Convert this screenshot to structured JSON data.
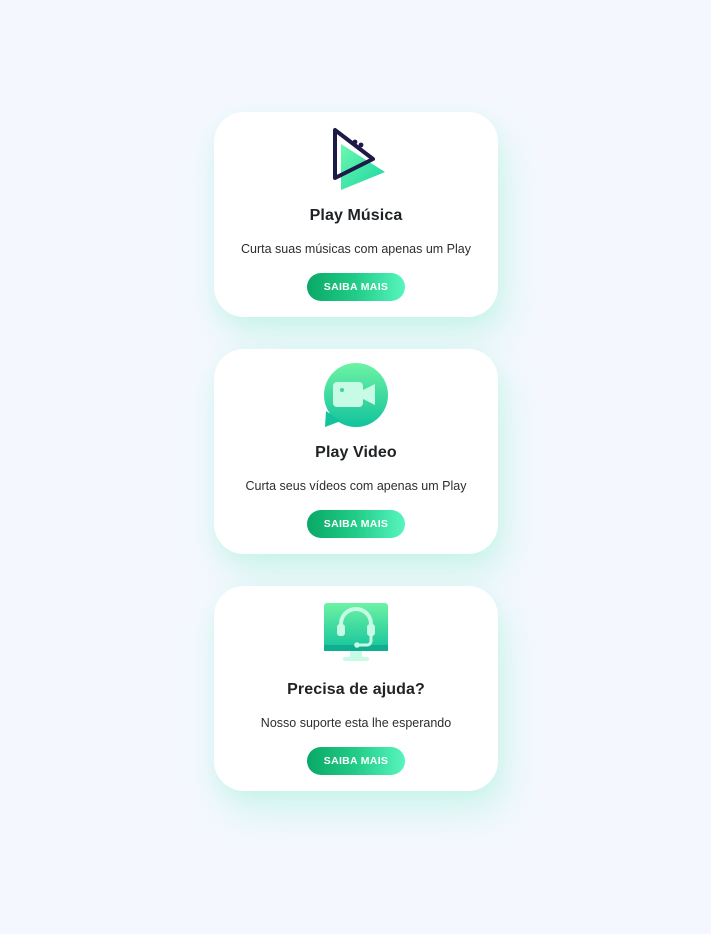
{
  "cards": [
    {
      "icon": "play-icon",
      "title": "Play Música",
      "description": "Curta suas músicas com apenas um Play",
      "button_label": "SAIBA MAIS"
    },
    {
      "icon": "video-camera-chat-icon",
      "title": "Play Video",
      "description": "Curta seus vídeos com apenas um Play",
      "button_label": "SAIBA MAIS"
    },
    {
      "icon": "support-headset-monitor-icon",
      "title": "Precisa de ajuda?",
      "description": "Nosso suporte esta lhe esperando",
      "button_label": "SAIBA MAIS"
    }
  ],
  "colors": {
    "background": "#f4f8fe",
    "card": "#ffffff",
    "accent_dark": "#0aa866",
    "accent_light": "#58f5bf",
    "icon_navy": "#1c1a47",
    "title_text": "#1f2224"
  }
}
